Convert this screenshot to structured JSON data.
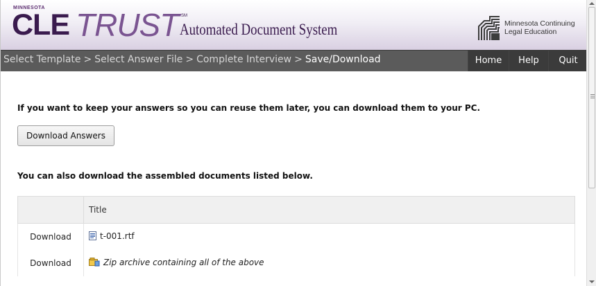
{
  "header": {
    "logo": {
      "state_prefix": "MINNESOTA",
      "brand_cle": "CLE",
      "brand_trust": "TRUST",
      "service_mark": "SM",
      "subtitle": "Automated Document System"
    },
    "org_name_line1": "Minnesota Continuing",
    "org_name_line2": "Legal Education"
  },
  "nav": {
    "breadcrumbs": [
      {
        "label": "Select Template"
      },
      {
        "label": "Select Answer File"
      },
      {
        "label": "Complete Interview"
      },
      {
        "label": "Save/Download"
      }
    ],
    "separator": ">",
    "buttons": {
      "home": "Home",
      "help": "Help",
      "quit": "Quit"
    }
  },
  "content": {
    "answers_prompt": "If you want to keep your answers so you can reuse them later, you can download them to your PC.",
    "download_answers_label": "Download Answers",
    "documents_prompt": "You can also download the assembled documents listed below.",
    "table": {
      "columns": [
        "",
        "Title"
      ],
      "rows": [
        {
          "action": "Download",
          "icon": "rtf-document-icon",
          "title": "t-001.rtf"
        },
        {
          "action": "Download",
          "icon": "zip-archive-icon",
          "title": "Zip archive containing all of the above"
        }
      ]
    }
  },
  "colors": {
    "brand_dark": "#3a1b4e",
    "brand_light": "#7a5491",
    "nav_bg": "#5b5b5b",
    "nav_button_bg": "#3b3b3b"
  }
}
